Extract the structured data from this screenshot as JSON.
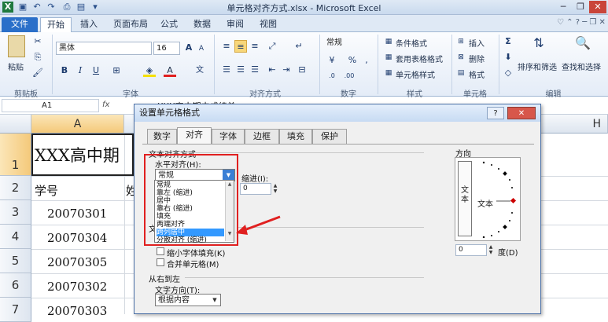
{
  "window": {
    "title": "单元格对齐方式.xlsx - Microsoft Excel",
    "qa_icons": [
      "excel-icon",
      "save-icon",
      "undo-icon",
      "redo-icon",
      "print-icon",
      "preview-icon",
      "customize-icon"
    ],
    "controls": [
      "minimize",
      "maximize",
      "close"
    ]
  },
  "tabs": [
    "文件",
    "开始",
    "插入",
    "页面布局",
    "公式",
    "数据",
    "审阅",
    "视图"
  ],
  "ribbon": {
    "clipboard": {
      "paste": "粘贴",
      "label": "剪贴板"
    },
    "font": {
      "name": "黑体",
      "size": "16",
      "bold": "B",
      "italic": "I",
      "underline": "U",
      "label": "字体"
    },
    "align": {
      "label": "对齐方式"
    },
    "number": {
      "format": "常规",
      "percent": "%",
      "comma": ",",
      "label": "数字"
    },
    "styles": {
      "cond": "条件格式",
      "table": "套用表格格式",
      "cell": "单元格样式",
      "label": "样式"
    },
    "cells": {
      "insert": "插入",
      "delete": "删除",
      "format": "格式",
      "label": "单元格"
    },
    "edit": {
      "sigma": "Σ",
      "sort": "排序和筛选",
      "find": "查找和选择",
      "label": "编辑"
    }
  },
  "formula_bar": {
    "name_box": "A1",
    "fx": "fx",
    "content": "XXX高中期中成绩单"
  },
  "sheet": {
    "columns": [
      "A",
      "H"
    ],
    "rows": [
      "1",
      "2",
      "3",
      "4",
      "5",
      "6",
      "7"
    ],
    "cells": {
      "a1": "XXX高中期",
      "a2": "学号",
      "b2": "姓",
      "ids": [
        "20070301",
        "20070304",
        "20070305",
        "20070302",
        "20070303"
      ]
    }
  },
  "dialog": {
    "title": "设置单元格格式",
    "help": "?",
    "close": "✕",
    "tabs": [
      "数字",
      "对齐",
      "字体",
      "边框",
      "填充",
      "保护"
    ],
    "section_text_align": "文本对齐方式",
    "horizontal_label": "水平对齐(H):",
    "horizontal_value": "常规",
    "indent_label": "缩进(I):",
    "indent_value": "0",
    "dropdown_options": [
      "常规",
      "靠左 (缩进)",
      "居中",
      "靠右 (缩进)",
      "填充",
      "两端对齐",
      "跨列居中",
      "分散对齐 (缩进)"
    ],
    "selected_option": "跨列居中",
    "section_text_control": "文",
    "shrink_label": "缩小字体填充(K)",
    "merge_label": "合并单元格(M)",
    "section_rtl": "从右到左",
    "direction_label": "文字方向(T):",
    "direction_value": "根据内容",
    "orientation_title": "方向",
    "orientation_vertical": "文本",
    "orientation_text": "文本",
    "degree_value": "0",
    "degree_label": "度(D)"
  },
  "colors": {
    "accent": "#2a6fc9",
    "highlight": "#e02020",
    "selection": "#3399ff"
  }
}
